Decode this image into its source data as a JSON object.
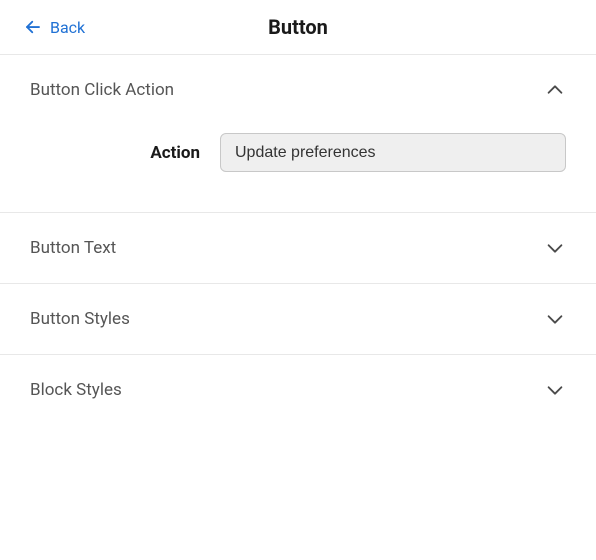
{
  "header": {
    "back_label": "Back",
    "title": "Button"
  },
  "sections": {
    "click_action": {
      "title": "Button Click Action",
      "expanded": true,
      "action_label": "Action",
      "action_value": "Update preferences"
    },
    "button_text": {
      "title": "Button Text",
      "expanded": false
    },
    "button_styles": {
      "title": "Button Styles",
      "expanded": false
    },
    "block_styles": {
      "title": "Block Styles",
      "expanded": false
    }
  },
  "colors": {
    "link": "#2071d4",
    "border": "#e8e8e8",
    "select_bg": "#efefef",
    "select_border": "#c8c8c8"
  }
}
